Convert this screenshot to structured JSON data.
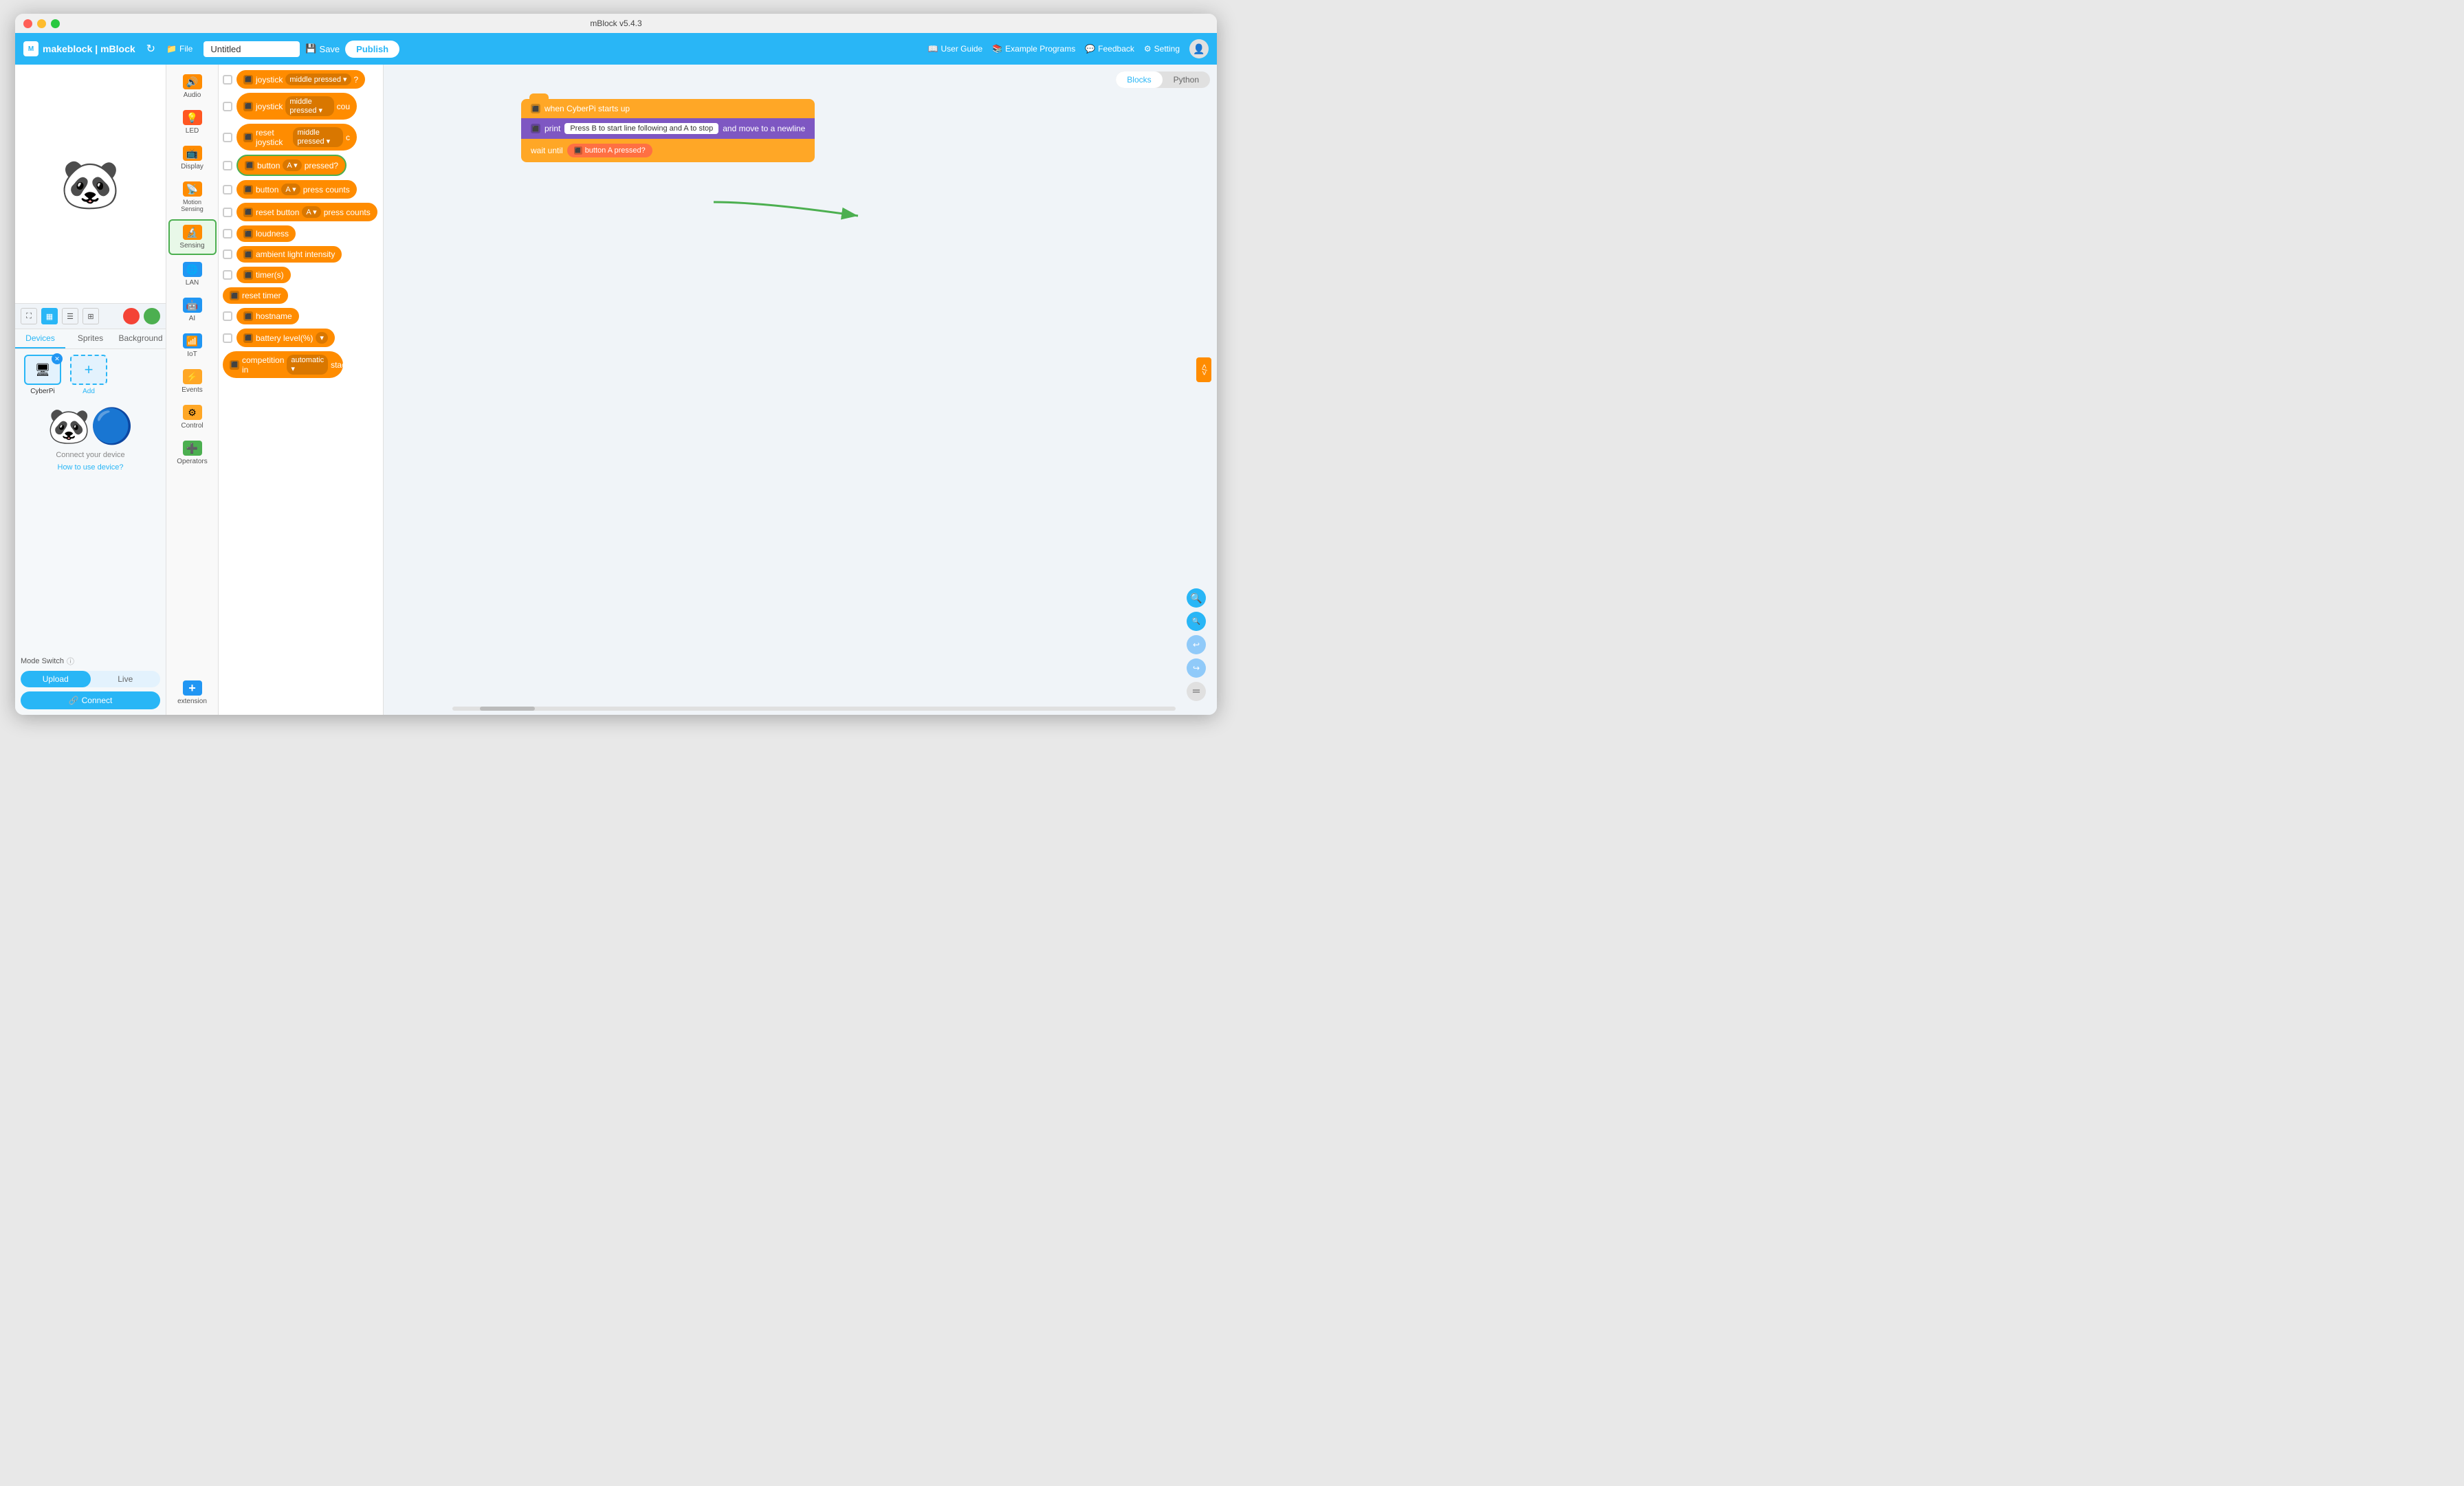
{
  "titlebar": {
    "title": "mBlock v5.4.3"
  },
  "toolbar": {
    "brand": "makeblock | mBlock",
    "file_label": "File",
    "save_label": "Save",
    "publish_label": "Publish",
    "project_name": "Untitled",
    "user_guide_label": "User Guide",
    "example_programs_label": "Example Programs",
    "feedback_label": "Feedback",
    "setting_label": "Setting"
  },
  "traffic_lights": {
    "red": "red",
    "yellow": "yellow",
    "green": "green"
  },
  "left_panel": {
    "tabs": [
      {
        "label": "Devices",
        "active": true
      },
      {
        "label": "Sprites",
        "active": false
      },
      {
        "label": "Background",
        "active": false
      }
    ],
    "devices": [
      {
        "label": "CyberPi",
        "emoji": "🖥"
      }
    ],
    "add_label": "Add",
    "sprite_label": "🐼🔵",
    "connect_text": "Connect your device",
    "how_to_label": "How to use device?",
    "mode_switch_label": "Mode Switch",
    "mode_upload": "Upload",
    "mode_live": "Live",
    "connect_btn": "Connect"
  },
  "categories": [
    {
      "label": "Audio",
      "color": "#ff8c00",
      "icon": "🔊"
    },
    {
      "label": "LED",
      "color": "#ff5722",
      "icon": "💡"
    },
    {
      "label": "Display",
      "color": "#ff8c00",
      "icon": "📺"
    },
    {
      "label": "Motion Sensing",
      "color": "#ff8c00",
      "icon": "📡"
    },
    {
      "label": "Sensing",
      "color": "#ff8c00",
      "icon": "🔬",
      "active": true
    },
    {
      "label": "LAN",
      "color": "#2196f3",
      "icon": "🌐"
    },
    {
      "label": "AI",
      "color": "#2196f3",
      "icon": "🤖"
    },
    {
      "label": "IoT",
      "color": "#2196f3",
      "icon": "📶"
    },
    {
      "label": "Events",
      "color": "#ffa726",
      "icon": "⚡"
    },
    {
      "label": "Control",
      "color": "#ffa726",
      "icon": "⚙"
    },
    {
      "label": "Operators",
      "color": "#4caf50",
      "icon": "➕"
    },
    {
      "label": "extension",
      "color": "#2196f3",
      "icon": "+"
    }
  ],
  "blocks": [
    {
      "id": "b1",
      "type": "reporter",
      "text": "joystick",
      "dropdown": "middle pressed",
      "has_question": true,
      "checked": false
    },
    {
      "id": "b2",
      "type": "reporter",
      "text": "joystick",
      "dropdown": "middle pressed",
      "suffix": "cou",
      "checked": false
    },
    {
      "id": "b3",
      "type": "stack",
      "text": "reset joystick",
      "dropdown": "middle pressed",
      "suffix": "c",
      "checked": false
    },
    {
      "id": "b4",
      "type": "reporter",
      "text": "button",
      "dropdown": "A",
      "suffix": "pressed?",
      "highlighted": true,
      "checked": false
    },
    {
      "id": "b5",
      "type": "reporter",
      "text": "button",
      "dropdown": "A",
      "suffix": "press counts",
      "checked": false
    },
    {
      "id": "b6",
      "type": "stack",
      "text": "reset button",
      "dropdown": "A",
      "suffix": "press counts",
      "checked": false
    },
    {
      "id": "b7",
      "type": "reporter",
      "text": "loudness",
      "checked": false
    },
    {
      "id": "b8",
      "type": "reporter",
      "text": "ambient light intensity",
      "checked": false
    },
    {
      "id": "b9",
      "type": "reporter",
      "text": "timer(s)",
      "checked": false
    },
    {
      "id": "b10",
      "type": "stack",
      "text": "reset timer",
      "checked": false
    },
    {
      "id": "b11",
      "type": "reporter",
      "text": "hostname",
      "checked": false
    },
    {
      "id": "b12",
      "type": "reporter",
      "text": "battery level(%)",
      "dropdown": true,
      "checked": false
    },
    {
      "id": "b13",
      "type": "stack",
      "text": "competition in",
      "dropdown": "automatic",
      "suffix": "stage",
      "checked": false
    }
  ],
  "code_canvas": {
    "tabs": [
      "Blocks",
      "Python"
    ],
    "active_tab": "Blocks",
    "hat_block": "when CyberPi starts up",
    "print_block": "print",
    "print_string": "Press B to start line following and A to stop",
    "print_suffix": "and move to a newline",
    "wait_block": "wait until",
    "wait_condition": "button  A  pressed?"
  },
  "zoom": {
    "zoom_in": "+",
    "zoom_out": "−",
    "reset": "⟳",
    "code": "</>"
  }
}
